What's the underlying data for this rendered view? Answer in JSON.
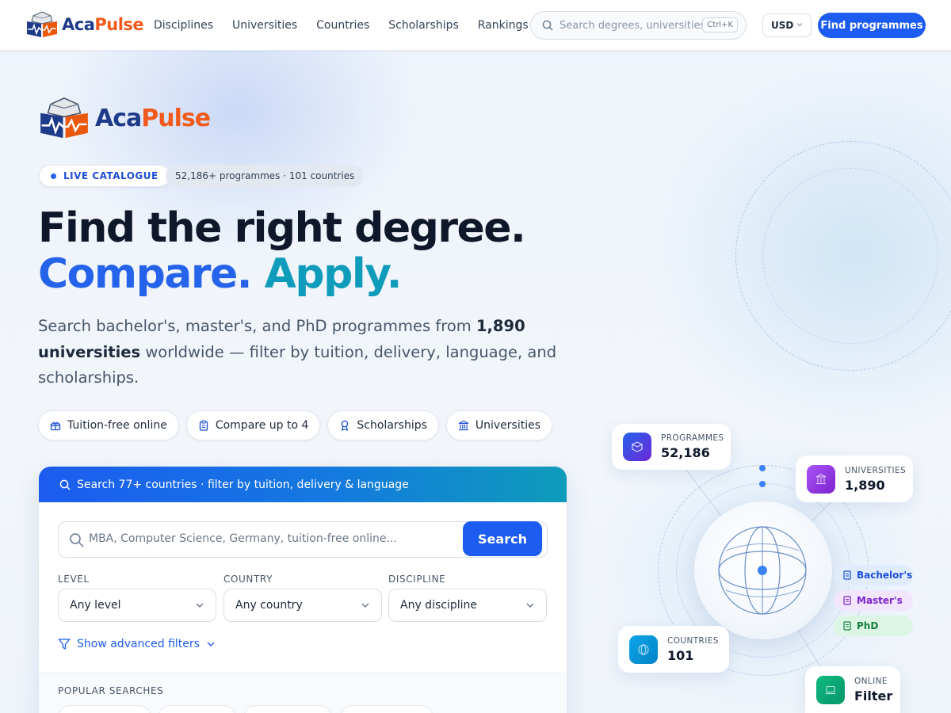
{
  "brand": {
    "name_part1": "Aca",
    "name_part2": "Pulse"
  },
  "nav": {
    "links": [
      "Disciplines",
      "Universities",
      "Countries",
      "Scholarships",
      "Rankings"
    ],
    "search_placeholder": "Search degrees, universities, countries",
    "shortcut": "Ctrl+K",
    "currency": "USD",
    "cta": "Find programmes"
  },
  "hero": {
    "live_label": "LIVE CATALOGUE",
    "stats_pill": "52,186+ programmes · 101 countries",
    "headline_line1": "Find the right degree.",
    "headline_compare": "Compare.",
    "headline_apply": "Apply.",
    "lead_before": "Search bachelor's, master's, and PhD programmes from ",
    "lead_bold": "1,890 universities",
    "lead_after": " worldwide — filter by tuition, delivery, language, and scholarships.",
    "chips": [
      {
        "icon": "gift-icon",
        "label": "Tuition-free online"
      },
      {
        "icon": "clipboard-icon",
        "label": "Compare up to 4"
      },
      {
        "icon": "award-icon",
        "label": "Scholarships"
      },
      {
        "icon": "university-icon",
        "label": "Universities"
      }
    ]
  },
  "search_card": {
    "header": "Search 77+ countries · filter by tuition, delivery & language",
    "placeholder": "MBA, Computer Science, Germany, tuition-free online...",
    "button": "Search",
    "filters": [
      {
        "label": "LEVEL",
        "value": "Any level"
      },
      {
        "label": "COUNTRY",
        "value": "Any country"
      },
      {
        "label": "DISCIPLINE",
        "value": "Any discipline"
      }
    ],
    "advanced": "Show advanced filters",
    "popular_label": "POPULAR SEARCHES"
  },
  "visual": {
    "stats": [
      {
        "label": "PROGRAMMES",
        "value": "52,186",
        "color": "#4f46e5"
      },
      {
        "label": "UNIVERSITIES",
        "value": "1,890",
        "color": "#9333ea"
      },
      {
        "label": "COUNTRIES",
        "value": "101",
        "color": "#0ea5e9"
      },
      {
        "label": "ONLINE",
        "value": "Filter",
        "color": "#10b981"
      }
    ],
    "levels": [
      {
        "label": "Bachelor's",
        "color": "#1d4ed8",
        "bg": "#e0ecfc"
      },
      {
        "label": "Master's",
        "color": "#7e22ce",
        "bg": "#f1e6fc"
      },
      {
        "label": "PhD",
        "color": "#15803d",
        "bg": "#dcf5e5"
      }
    ]
  }
}
